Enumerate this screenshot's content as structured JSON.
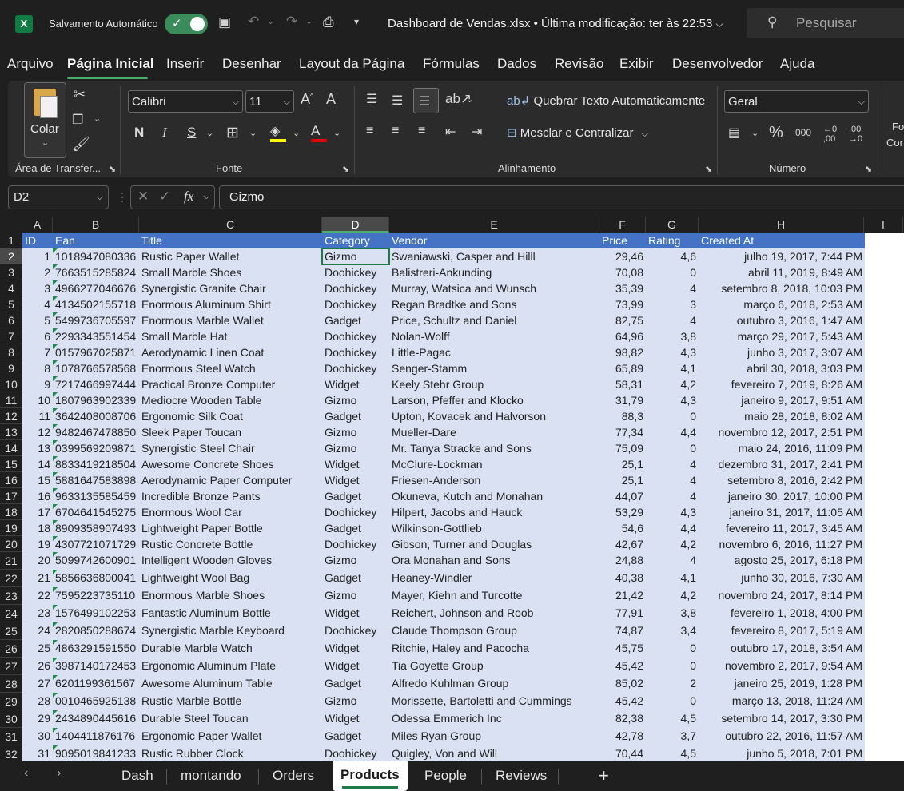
{
  "titlebar": {
    "autosave_label": "Salvamento Automático",
    "document_title": "Dashboard de Vendas.xlsx • Última modificação: ter às 22:53",
    "search_placeholder": "Pesquisar"
  },
  "menu": [
    "Arquivo",
    "Página Inicial",
    "Inserir",
    "Desenhar",
    "Layout da Página",
    "Fórmulas",
    "Dados",
    "Revisão",
    "Exibir",
    "Desenvolvedor",
    "Ajuda"
  ],
  "ribbon": {
    "paste_label": "Colar",
    "clipboard_group": "Área de Transfer...",
    "font_group": "Fonte",
    "font_name": "Calibri",
    "font_size": "11",
    "bold": "N",
    "italic": "I",
    "underline": "S",
    "wrap_text": "Quebrar Texto Automaticamente",
    "merge_center": "Mesclar e Centralizar",
    "alignment_group": "Alinhamento",
    "number_format": "Geral",
    "number_group": "Número",
    "cut_off_label_1": "Fo",
    "cut_off_label_2": "Cor"
  },
  "formula_bar": {
    "name_box": "D2",
    "fx": "fx",
    "value": "Gizmo"
  },
  "columns": [
    "A",
    "B",
    "C",
    "D",
    "E",
    "F",
    "G",
    "H",
    "I"
  ],
  "selected_column": "D",
  "selected_row": "2",
  "headers": [
    "ID",
    "Ean",
    "Title",
    "Category",
    "Vendor",
    "Price",
    "Rating",
    "Created At"
  ],
  "rows": [
    [
      "1",
      "1018947080336",
      "Rustic Paper Wallet",
      "Gizmo",
      "Swaniawski, Casper and Hilll",
      "29,46",
      "4,6",
      "julho 19, 2017, 7:44 PM"
    ],
    [
      "2",
      "7663515285824",
      "Small Marble Shoes",
      "Doohickey",
      "Balistreri-Ankunding",
      "70,08",
      "0",
      "abril 11, 2019, 8:49 AM"
    ],
    [
      "3",
      "4966277046676",
      "Synergistic Granite Chair",
      "Doohickey",
      "Murray, Watsica and Wunsch",
      "35,39",
      "4",
      "setembro 8, 2018, 10:03 PM"
    ],
    [
      "4",
      "4134502155718",
      "Enormous Aluminum Shirt",
      "Doohickey",
      "Regan Bradtke and Sons",
      "73,99",
      "3",
      "março 6, 2018, 2:53 AM"
    ],
    [
      "5",
      "5499736705597",
      "Enormous Marble Wallet",
      "Gadget",
      "Price, Schultz and Daniel",
      "82,75",
      "4",
      "outubro 3, 2016, 1:47 AM"
    ],
    [
      "6",
      "2293343551454",
      "Small Marble Hat",
      "Doohickey",
      "Nolan-Wolff",
      "64,96",
      "3,8",
      "março 29, 2017, 5:43 AM"
    ],
    [
      "7",
      "0157967025871",
      "Aerodynamic Linen Coat",
      "Doohickey",
      "Little-Pagac",
      "98,82",
      "4,3",
      "junho 3, 2017, 3:07 AM"
    ],
    [
      "8",
      "1078766578568",
      "Enormous Steel Watch",
      "Doohickey",
      "Senger-Stamm",
      "65,89",
      "4,1",
      "abril 30, 2018, 3:03 PM"
    ],
    [
      "9",
      "7217466997444",
      "Practical Bronze Computer",
      "Widget",
      "Keely Stehr Group",
      "58,31",
      "4,2",
      "fevereiro 7, 2019, 8:26 AM"
    ],
    [
      "10",
      "1807963902339",
      "Mediocre Wooden Table",
      "Gizmo",
      "Larson, Pfeffer and Klocko",
      "31,79",
      "4,3",
      "janeiro 9, 2017, 9:51 AM"
    ],
    [
      "11",
      "3642408008706",
      "Ergonomic Silk Coat",
      "Gadget",
      "Upton, Kovacek and Halvorson",
      "88,3",
      "0",
      "maio 28, 2018, 8:02 AM"
    ],
    [
      "12",
      "9482467478850",
      "Sleek Paper Toucan",
      "Gizmo",
      "Mueller-Dare",
      "77,34",
      "4,4",
      "novembro 12, 2017, 2:51 PM"
    ],
    [
      "13",
      "0399569209871",
      "Synergistic Steel Chair",
      "Gizmo",
      "Mr. Tanya Stracke and Sons",
      "75,09",
      "0",
      "maio 24, 2016, 11:09 PM"
    ],
    [
      "14",
      "8833419218504",
      "Awesome Concrete Shoes",
      "Widget",
      "McClure-Lockman",
      "25,1",
      "4",
      "dezembro 31, 2017, 2:41 PM"
    ],
    [
      "15",
      "5881647583898",
      "Aerodynamic Paper Computer",
      "Widget",
      "Friesen-Anderson",
      "25,1",
      "4",
      "setembro 8, 2016, 2:42 PM"
    ],
    [
      "16",
      "9633135585459",
      "Incredible Bronze Pants",
      "Gadget",
      "Okuneva, Kutch and Monahan",
      "44,07",
      "4",
      "janeiro 30, 2017, 10:00 PM"
    ],
    [
      "17",
      "6704641545275",
      "Enormous Wool Car",
      "Doohickey",
      "Hilpert, Jacobs and Hauck",
      "53,29",
      "4,3",
      "janeiro 31, 2017, 11:05 AM"
    ],
    [
      "18",
      "8909358907493",
      "Lightweight Paper Bottle",
      "Gadget",
      "Wilkinson-Gottlieb",
      "54,6",
      "4,4",
      "fevereiro 11, 2017, 3:45 AM"
    ],
    [
      "19",
      "4307721071729",
      "Rustic Concrete Bottle",
      "Doohickey",
      "Gibson, Turner and Douglas",
      "42,67",
      "4,2",
      "novembro 6, 2016, 11:27 PM"
    ],
    [
      "20",
      "5099742600901",
      "Intelligent Wooden Gloves",
      "Gizmo",
      "Ora Monahan and Sons",
      "24,88",
      "4",
      "agosto 25, 2017, 6:18 PM"
    ],
    [
      "21",
      "5856636800041",
      "Lightweight Wool Bag",
      "Gadget",
      "Heaney-Windler",
      "40,38",
      "4,1",
      "junho 30, 2016, 7:30 AM"
    ],
    [
      "22",
      "7595223735110",
      "Enormous Marble Shoes",
      "Gizmo",
      "Mayer, Kiehn and Turcotte",
      "21,42",
      "4,2",
      "novembro 24, 2017, 8:14 PM"
    ],
    [
      "23",
      "1576499102253",
      "Fantastic Aluminum Bottle",
      "Widget",
      "Reichert, Johnson and Roob",
      "77,91",
      "3,8",
      "fevereiro 1, 2018, 4:00 PM"
    ],
    [
      "24",
      "2820850288674",
      "Synergistic Marble Keyboard",
      "Doohickey",
      "Claude Thompson Group",
      "74,87",
      "3,4",
      "fevereiro 8, 2017, 5:19 AM"
    ],
    [
      "25",
      "4863291591550",
      "Durable Marble Watch",
      "Widget",
      "Ritchie, Haley and Pacocha",
      "45,75",
      "0",
      "outubro 17, 2018, 3:54 AM"
    ],
    [
      "26",
      "3987140172453",
      "Ergonomic Aluminum Plate",
      "Widget",
      "Tia Goyette Group",
      "45,42",
      "0",
      "novembro 2, 2017, 9:54 AM"
    ],
    [
      "27",
      "6201199361567",
      "Awesome Aluminum Table",
      "Gadget",
      "Alfredo Kuhlman Group",
      "85,02",
      "2",
      "janeiro 25, 2019, 1:28 PM"
    ],
    [
      "28",
      "0010465925138",
      "Rustic Marble Bottle",
      "Gizmo",
      "Morissette, Bartoletti and Cummings",
      "45,42",
      "0",
      "março 13, 2018, 11:24 AM"
    ],
    [
      "29",
      "2434890445616",
      "Durable Steel Toucan",
      "Widget",
      "Odessa Emmerich Inc",
      "82,38",
      "4,5",
      "setembro 14, 2017, 3:30 PM"
    ],
    [
      "30",
      "1404411876176",
      "Ergonomic Paper Wallet",
      "Gadget",
      "Miles Ryan Group",
      "42,78",
      "3,7",
      "outubro 22, 2016, 11:57 AM"
    ],
    [
      "31",
      "9095019841233",
      "Rustic Rubber Clock",
      "Doohickey",
      "Quigley, Von and Will",
      "70,44",
      "4,5",
      "junho 5, 2018, 7:01 PM"
    ]
  ],
  "sheet_tabs": [
    "Dash",
    "montando",
    "Orders",
    "Products",
    "People",
    "Reviews"
  ],
  "active_tab": "Products",
  "colors": {
    "accent": "#107c41",
    "header_fill": "#4472c4",
    "band_fill": "#d9e1f2"
  }
}
